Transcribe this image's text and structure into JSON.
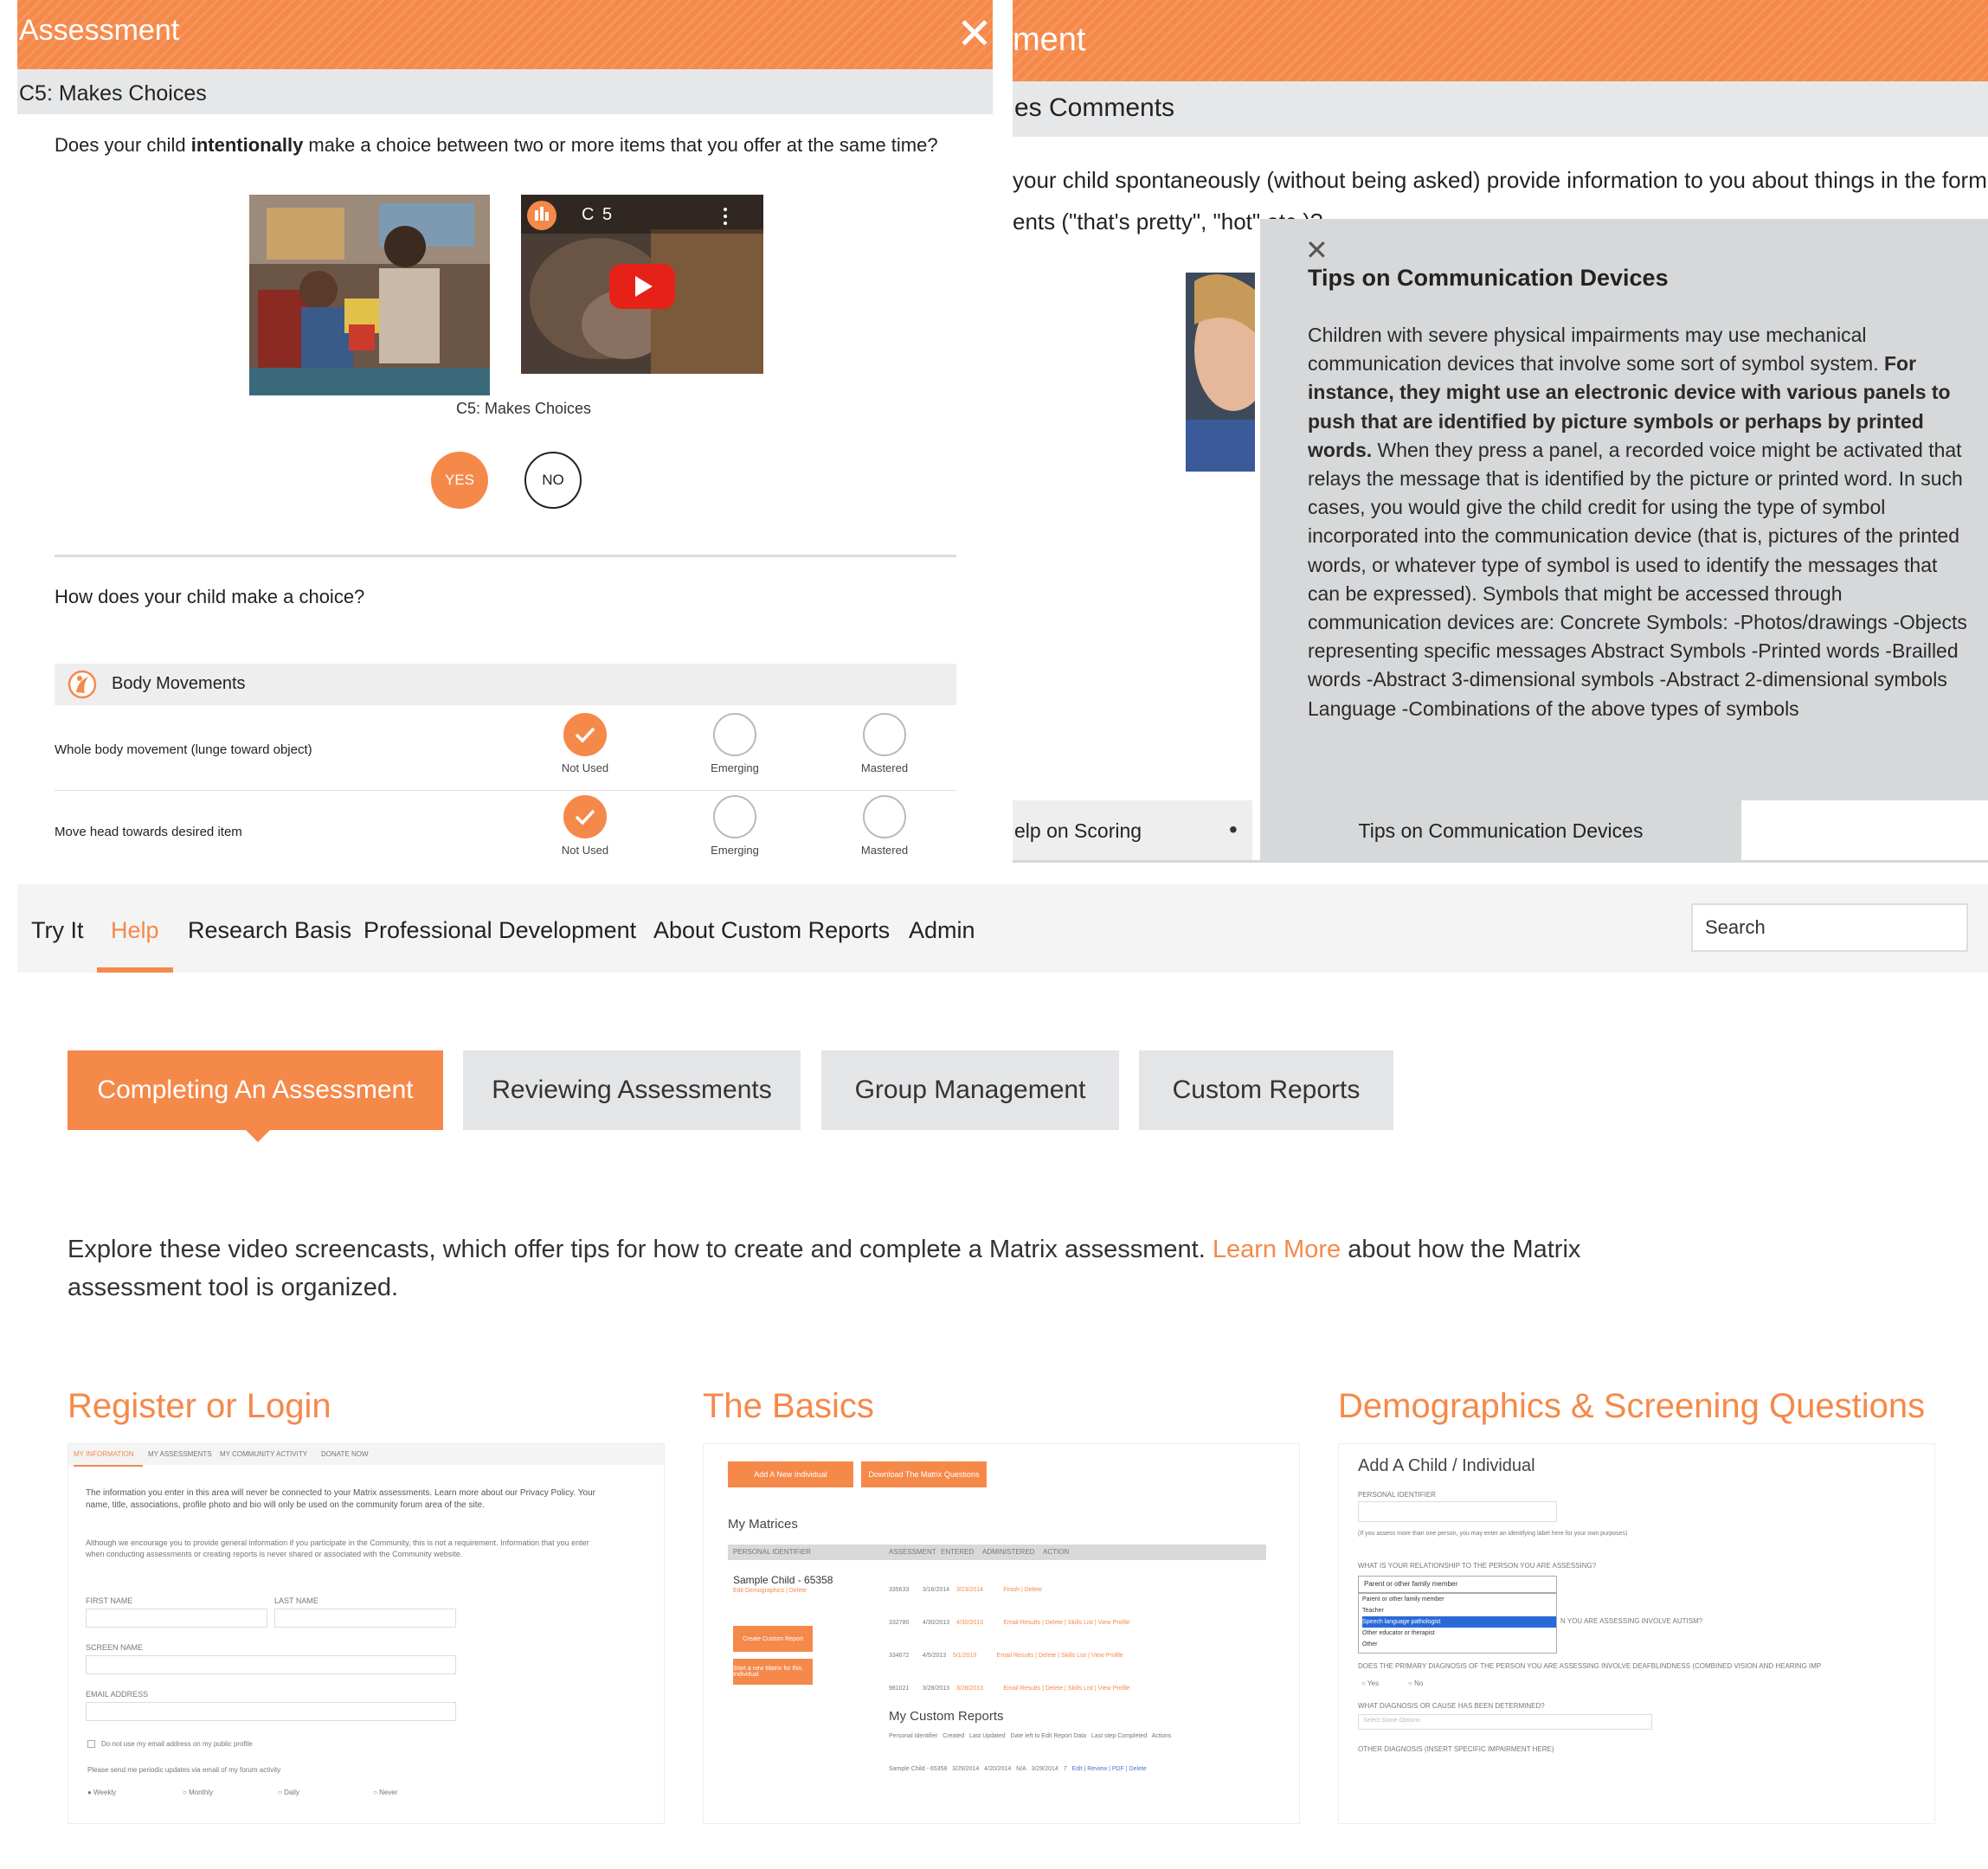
{
  "panel_a": {
    "header_title": "Assessment",
    "subheader": "C5: Makes Choices",
    "question_pre": "Does your child ",
    "question_bold": "intentionally",
    "question_post": " make a choice between two or more items that you offer at the same time?",
    "video_title": "C 5",
    "caption": "C5: Makes Choices",
    "yes_label": "YES",
    "no_label": "NO",
    "question2": "How does your child make a choice?",
    "category_label": "Body Movements",
    "rows": [
      {
        "label": "Whole body movement (lunge toward object)"
      },
      {
        "label": "Move head towards desired item"
      }
    ],
    "options": [
      "Not Used",
      "Emerging",
      "Mastered"
    ]
  },
  "panel_b": {
    "header_title": "ment",
    "subheader": "es Comments",
    "question_line1": "your child spontaneously (without being asked) provide information to you about things in the form",
    "question_line2": "ents (\"that's pretty\", \"hot\" etc.)?",
    "tip_title": "Tips on Communication Devices",
    "tip_body_1": "Children with severe physical impairments may use mechanical communication devices that involve some sort of symbol system. ",
    "tip_body_bold": "For instance, they might use an electronic device with various panels to push that are identified by picture symbols or perhaps by printed words.",
    "tip_body_2": " When they press a panel, a recorded voice might be activated that relays the message that is identified by the picture or printed word. In such cases, you would give the child credit for using the type of symbol incorporated into the communication device (that is, pictures of the printed words, or whatever type of symbol is used to identify the messages that can be expressed). Symbols that might be accessed through communication devices are: Concrete Symbols: -Photos/drawings -Objects representing specific messages Abstract Symbols -Printed words -Brailled words -Abstract 3-dimensional symbols -Abstract 2-dimensional symbols Language -Combinations of the above types of symbols",
    "tab_left": "elp on Scoring",
    "tab_dot": "•",
    "tab_active": "Tips on Communication Devices"
  },
  "panel_c": {
    "nav": [
      "Try It",
      "Help",
      "Research Basis",
      "Professional Development",
      "About Custom Reports",
      "Admin"
    ],
    "search_placeholder": "Search",
    "tabs": [
      "Completing An Assessment",
      "Reviewing Assessments",
      "Group Management",
      "Custom Reports"
    ],
    "intro_pre": "Explore these video screencasts, which offer tips for how to create and complete a Matrix assessment. ",
    "intro_link": "Learn More",
    "intro_post": " about how the Matrix assessment tool is organized.",
    "sections": [
      "Register or Login",
      "The Basics",
      "Demographics & Screening Questions"
    ],
    "shot1": {
      "tabs": [
        "MY INFORMATION",
        "MY ASSESSMENTS",
        "MY COMMUNITY ACTIVITY",
        "DONATE NOW"
      ],
      "text1": "The information you enter in this area will never be connected to your Matrix assessments. Learn more about our Privacy Policy. Your name, title, associations, profile photo and bio will only be used on the community forum area of the site.",
      "text2": "Although we encourage you to provide general information if you participate in the Community, this is not a requirement. Information that you enter when conducting assessments or creating reports is never shared or associated with the Community website.",
      "first_name": "FIRST NAME",
      "last_name": "LAST NAME",
      "screen_name": "SCREEN NAME",
      "email": "EMAIL ADDRESS",
      "checkbox": "Do not use my email address on my public profile",
      "notify": "Please send me periodic updates via email of my forum activity",
      "freq": [
        "Weekly",
        "Monthly",
        "Daily",
        "Never"
      ]
    },
    "shot2": {
      "btn1": "Add A New Individual",
      "btn2": "Download The Matrix Questions",
      "my_matrices": "My Matrices",
      "cols": [
        "PERSONAL IDENTIFIER",
        "ASSESSMENT",
        "ENTERED",
        "ADMINISTERED",
        "ACTION"
      ],
      "child": "Sample Child - 65358",
      "child_sub": "Edit Demographics | Delete",
      "btn3": "Create Custom Report",
      "btn4": "Start a new Matrix for this Individual",
      "rows": [
        [
          "335633",
          "3/16/2014",
          "3/23/2014",
          "Finish | Delete"
        ],
        [
          "332780",
          "4/30/2013",
          "4/30/2013",
          "Email Results | Delete | Skills List | View Profile"
        ],
        [
          "334672",
          "4/5/2013",
          "5/1/2013",
          "Email Results | Delete | Skills List | View Profile"
        ],
        [
          "981021",
          "3/28/2013",
          "3/28/2013",
          "Email Results | Delete | Skills List | View Profile"
        ]
      ],
      "custom_reports": "My Custom Reports",
      "cr_cols": [
        "Personal Identifier",
        "Created",
        "Last Updated",
        "Date left to Edit Report Data",
        "Last step Completed",
        "Actions"
      ],
      "cr_row": [
        "Sample Child - 65358",
        "3/29/2014",
        "4/20/2014",
        "N/A",
        "3/29/2014",
        "7",
        "Edit | Review | PDF | Delete"
      ]
    },
    "shot3": {
      "title": "Add A Child / Individual",
      "pid": "PERSONAL IDENTIFIER",
      "pid_note": "(If you assess more than one person, you may enter an identifying label here for your own purposes)",
      "rel_q": "WHAT IS YOUR RELATIONSHIP TO THE PERSON YOU ARE ASSESSING?",
      "rel_selected": "Parent or other family member",
      "rel_options": [
        "Parent or other family member",
        "Teacher",
        "Speech language pathologist",
        "Other educator or therapist",
        "Other"
      ],
      "autism_q": "N YOU ARE ASSESSING INVOLVE AUTISM?",
      "db_q": "DOES THE PRIMARY DIAGNOSIS OF THE PERSON YOU ARE ASSESSING INVOLVE DEAFBLINDNESS (COMBINED VISION AND HEARING IMP",
      "yes": "Yes",
      "no": "No",
      "cause_q": "WHAT DIAGNOSIS OR CAUSE HAS BEEN DETERMINED?",
      "cause_ph": "Select Some Options",
      "other_q": "OTHER DIAGNOSIS (INSERT SPECIFIC IMPAIRMENT HERE)"
    }
  }
}
